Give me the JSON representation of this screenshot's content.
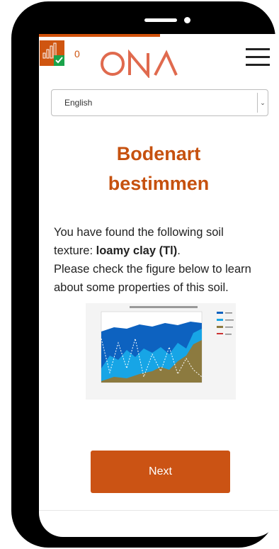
{
  "header": {
    "counter": "0",
    "logo_text": "ONA",
    "menu_icon": "hamburger-icon",
    "signal_icon": "signal-bars-icon",
    "check_icon": "check-icon"
  },
  "language": {
    "selected": "English",
    "arrow_icon": "chevron-down-icon"
  },
  "page": {
    "title_line1": "Bodenart",
    "title_line2": "bestimmen",
    "text_line1": "You have found the following soil",
    "text_line2_prefix": "texture: ",
    "text_line2_bold": "loamy clay (Tl)",
    "text_line2_suffix": ".",
    "text_line3": "Please check the figure below to learn",
    "text_line4": "about some properties of this soil."
  },
  "actions": {
    "next_label": "Next"
  },
  "colors": {
    "accent": "#cb5314",
    "chart_dark": "#0d62c0",
    "chart_light": "#17a5e6",
    "chart_olive": "#8c7a3f"
  }
}
